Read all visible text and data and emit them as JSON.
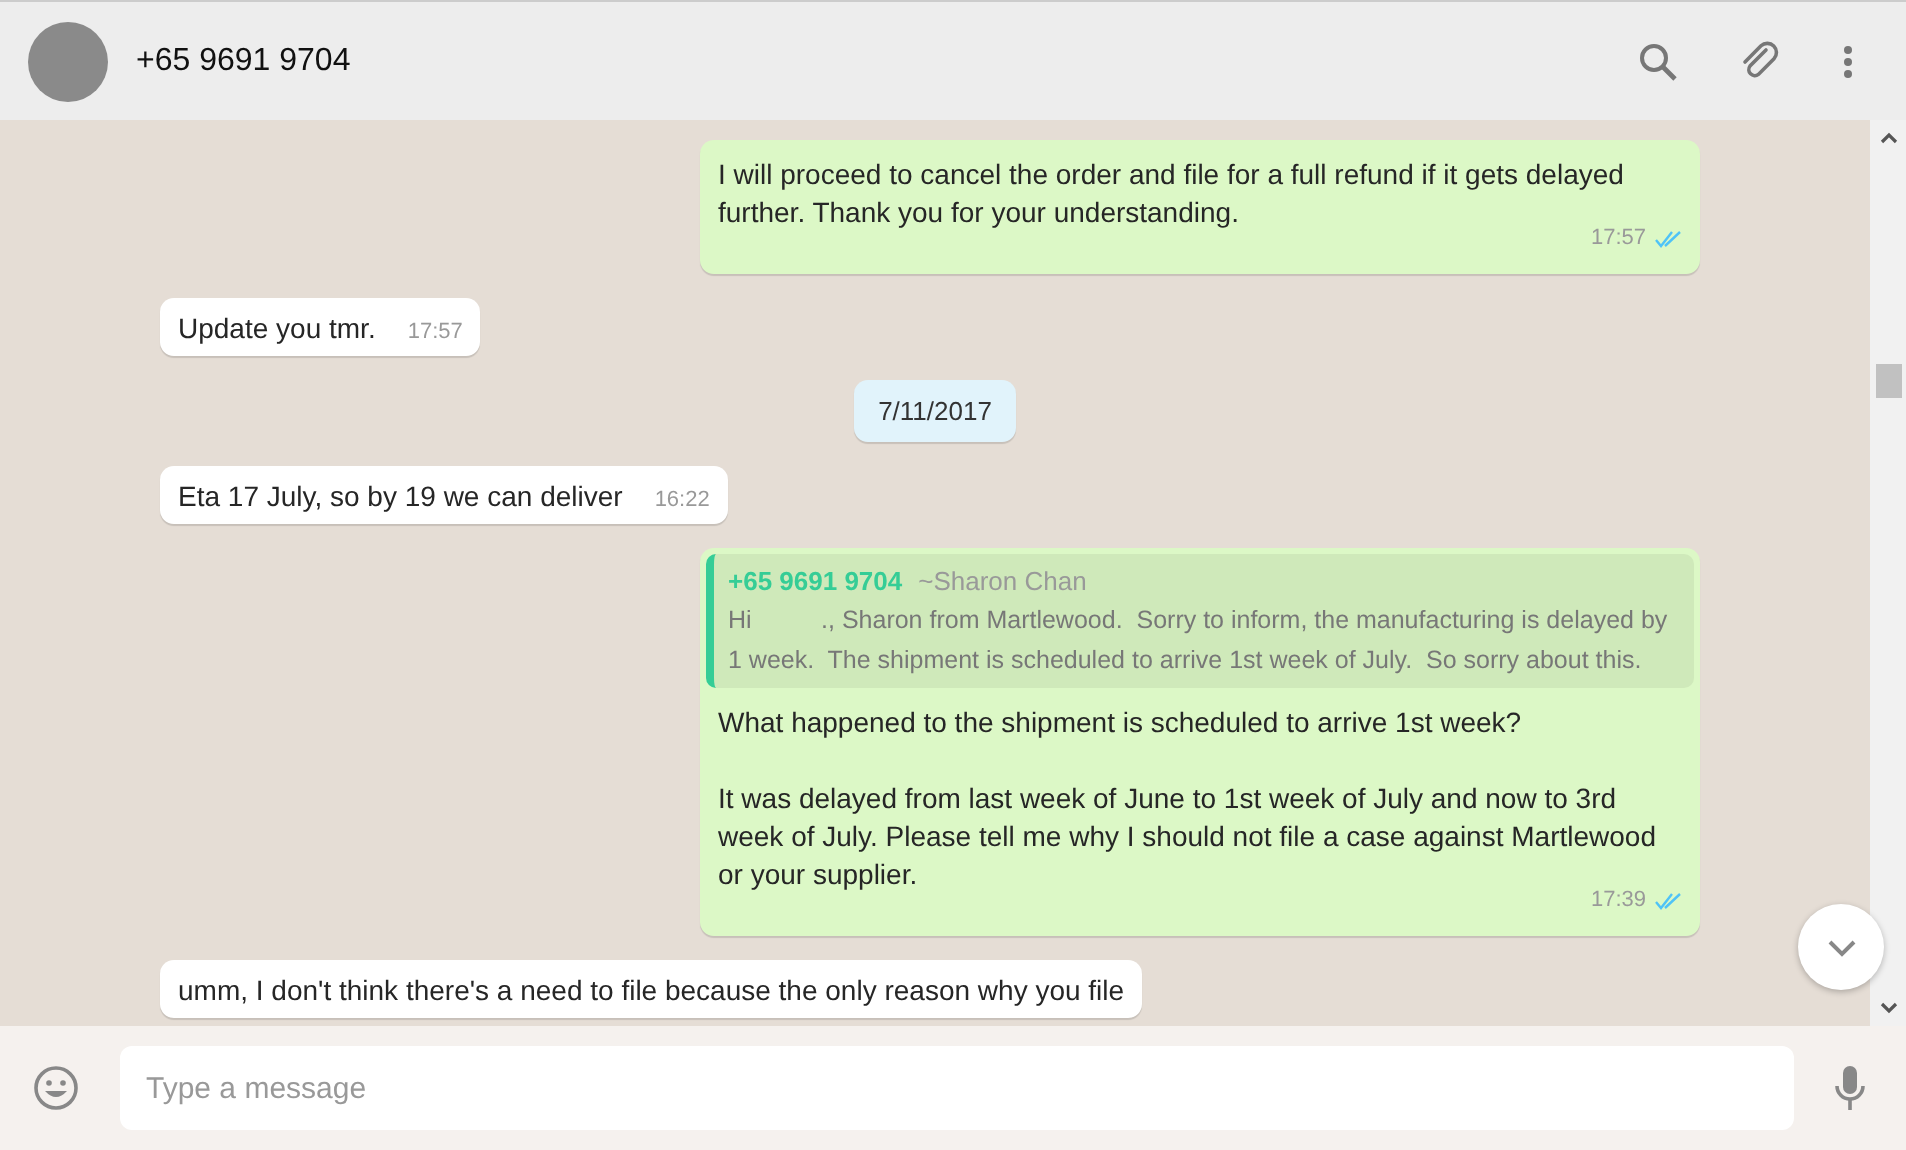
{
  "header": {
    "title": "+65 9691 9704"
  },
  "messages": [
    {
      "kind": "out",
      "text": "I will proceed to cancel the order and file for a full refund if it gets delayed further. Thank you for your understanding.",
      "time": "17:57",
      "read": true
    },
    {
      "kind": "in",
      "text": "Update you tmr.",
      "time": "17:57"
    },
    {
      "kind": "date",
      "text": "7/11/2017"
    },
    {
      "kind": "in",
      "text": "Eta 17 July, so by 19 we can deliver",
      "time": "16:22"
    },
    {
      "kind": "out",
      "quote": {
        "sender": "+65 9691 9704",
        "name": "~Sharon Chan",
        "text": "Hi          ., Sharon from Martlewood.  Sorry to inform, the manufacturing is delayed by 1 week.  The shipment is scheduled to arrive 1st week of July.  So sorry about this."
      },
      "text": "What happened to the shipment is scheduled to arrive 1st week?\n\nIt was delayed from last week of June to 1st week of July and now to 3rd week of July. Please tell me why I should not file a case against Martlewood or your supplier.",
      "time": "17:39",
      "read": true
    },
    {
      "kind": "in",
      "text": "umm, I don't think there's a need to file because the only reason why you file"
    }
  ],
  "composer": {
    "placeholder": "Type a message"
  }
}
